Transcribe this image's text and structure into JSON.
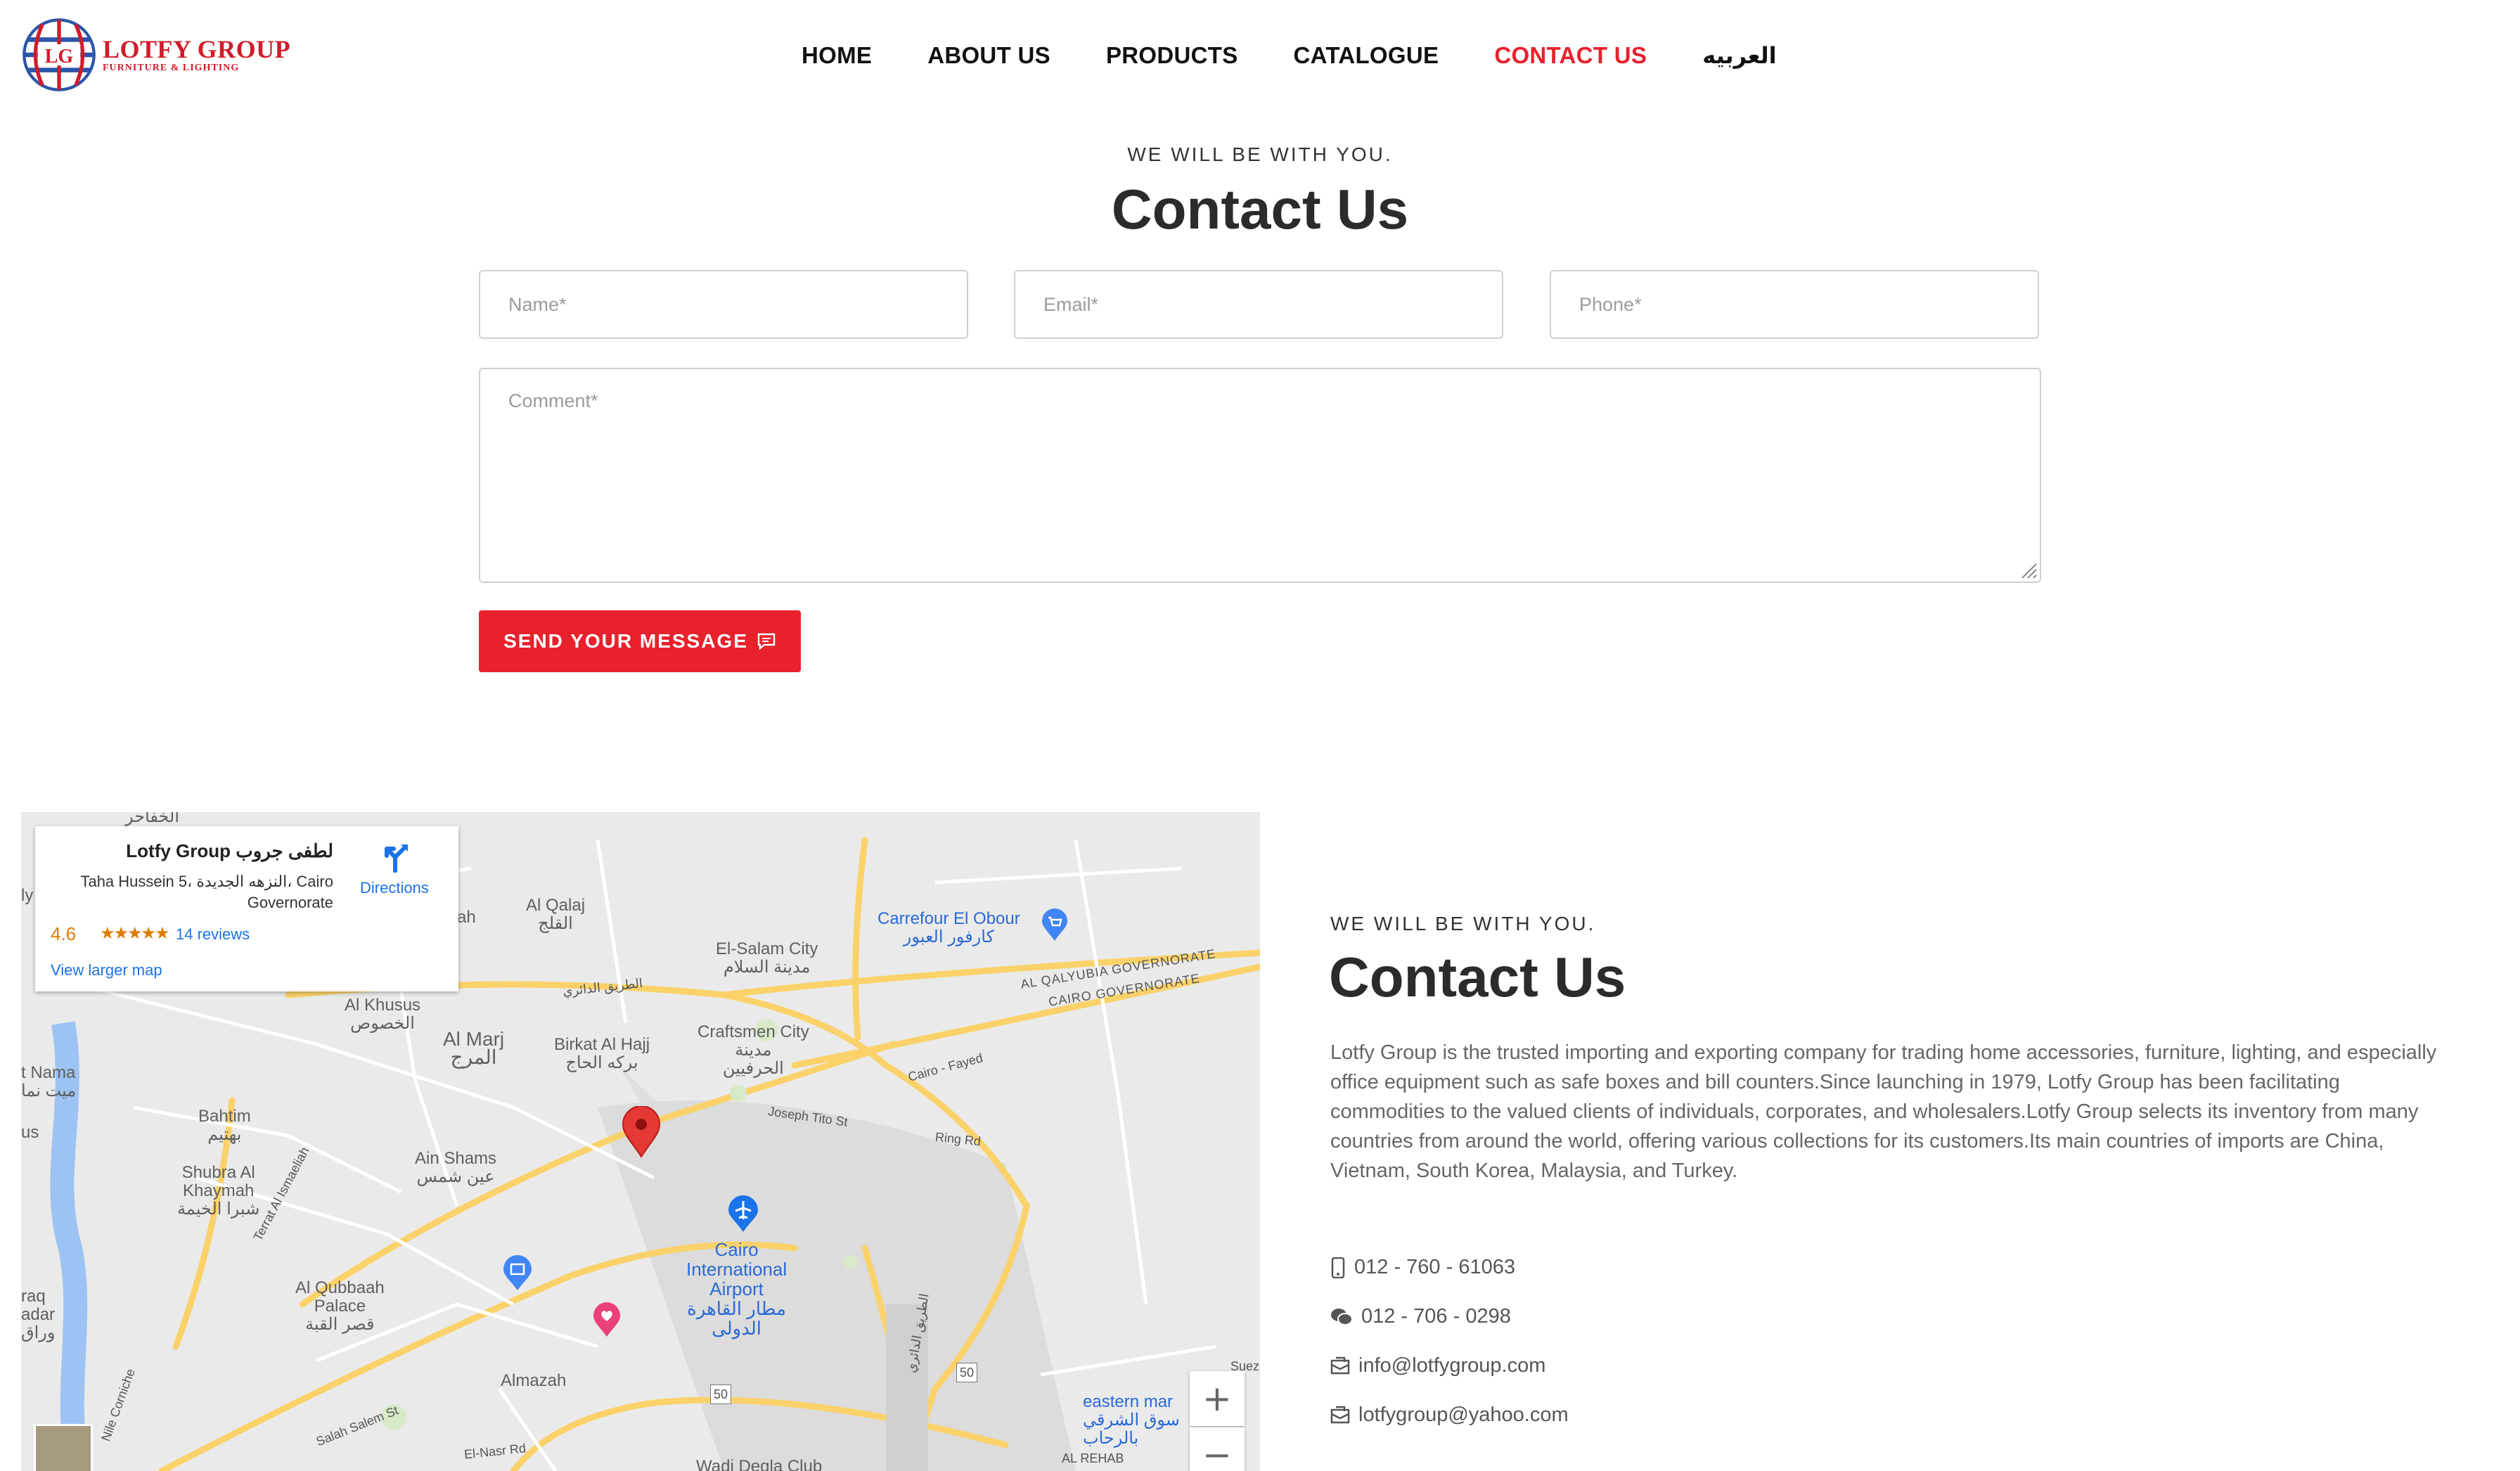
{
  "brand": {
    "monogram": "LG",
    "name": "LOTFY GROUP",
    "tagline": "FURNITURE & LIGHTING"
  },
  "nav": {
    "items": [
      "HOME",
      "ABOUT US",
      "PRODUCTS",
      "CATALOGUE",
      "CONTACT US",
      "العربيه"
    ],
    "active": "CONTACT US",
    "active_color": "#e8212d"
  },
  "form_section": {
    "eyebrow": "WE WILL BE WITH YOU.",
    "title": "Contact Us",
    "name_placeholder": "Name*",
    "email_placeholder": "Email*",
    "phone_placeholder": "Phone*",
    "comment_placeholder": "Comment*",
    "send_label": "SEND YOUR MESSAGE",
    "send_icon": "chat-bubble-icon",
    "button_color": "#e8212d"
  },
  "map": {
    "card": {
      "title": "Lotfy Group لطفى جروب",
      "address": "Taha Hussein 5، النزهه الجديدة، Cairo Governorate",
      "rating": "4.6",
      "stars": "★★★★★",
      "reviews": "14 reviews",
      "view_larger": "View larger map",
      "directions": "Directions"
    },
    "labels": {
      "al_qalaj": "Al Qalaj\nالقلج",
      "el_salam": "El-Salam City\nمدينة السلام",
      "carrefour": "Carrefour El Obour\nكارفور العبور",
      "qalyubia": "AL QALYUBIA GOVERNORATE",
      "cairo_gov": "CAIRO GOVERNORATE",
      "al_khusus": "Al Khusus\nالخصوص",
      "al_marj": "Al Marj\nالمرج",
      "birkat": "Birkat Al Hajj\nبركه الحاج",
      "craftsmen": "Craftsmen City\nمدينة\nالحرفيين",
      "bahtim": "Bahtim\nبهتيم",
      "ain_shams": "Ain Shams\nعين شمس",
      "shubra": "Shubra Al\nKhaymah\nشبرا الخيمة",
      "airport": "Cairo\nInternational\nAirport\nمطار القاهرة\nالدولى",
      "qubbah": "Al Qubbaah\nPalace\nقصر القبة",
      "almazah": "Almazah",
      "eastern": "eastern mar\nسوق الشرقي\nبالرحاب",
      "al_rehab": "AL REHAB",
      "wadi_degla": "Wadi Degla Club",
      "joseph_tito": "Joseph Tito St",
      "ring_rd": "Ring Rd",
      "cairo_fayed": "Cairo - Fayed",
      "salah_salem": "Salah Salem St",
      "el_nasr": "El-Nasr Rd",
      "suez": "Suez",
      "hwy_50a": "50",
      "hwy_50b": "50",
      "nile_corniche": "Nile Corniche",
      "terrat": "Terrat Al Ismaeliah",
      "edge_ah": "ah",
      "edge_ly": "ly\nah",
      "edge_nama": "t Nama\nميت نما",
      "edge_us": "us",
      "edge_raq": "raq\nadar\nوراق",
      "top_label": "الخفاحر",
      "ring_ar": "الطريق الدائري",
      "ring_ar2": "الطريق الدائري"
    },
    "zoom_in": "+",
    "zoom_out": "−"
  },
  "info_section": {
    "eyebrow": "WE WILL BE WITH YOU.",
    "title": "Contact Us",
    "text": "Lotfy Group is the trusted importing and exporting company for trading home accessories, furniture, lighting, and especially office equipment such as safe boxes and bill counters.Since launching in 1979, Lotfy Group has been facilitating commodities to the valued clients of individuals, corporates, and wholesalers.Lotfy Group selects its inventory from many countries from around the world, offering various collections for its customers.Its main countries of imports are China, Vietnam, South Korea, Malaysia, and Turkey.",
    "contacts": [
      {
        "icon": "mobile-phone-icon",
        "value": "012 - 760 - 61063"
      },
      {
        "icon": "chat-bubbles-icon",
        "value": "012 - 706 - 0298"
      },
      {
        "icon": "envelope-icon",
        "value": "info@lotfygroup.com"
      },
      {
        "icon": "envelope-icon",
        "value": "lotfygroup@yahoo.com"
      }
    ]
  }
}
